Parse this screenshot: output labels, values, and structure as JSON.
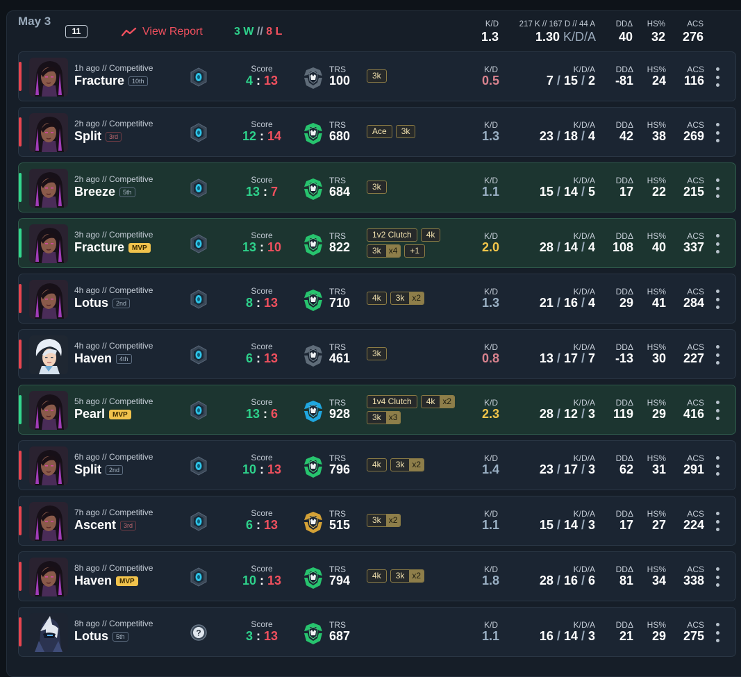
{
  "header": {
    "date": "May 3",
    "match_count": "11",
    "view_report": "View Report",
    "wins": "3 W",
    "sep": " // ",
    "losses": "8 L",
    "kd_label": "K/D",
    "kd_value": "1.3",
    "kda_label": "217 K // 167 D // 44 A",
    "kda_value": "1.30",
    "kda_suffix": " K/D/A",
    "dd_label": "DDΔ",
    "dd_value": "40",
    "hs_label": "HS%",
    "hs_value": "32",
    "acs_label": "ACS",
    "acs_value": "276"
  },
  "labels": {
    "score": "Score",
    "trs": "TRS",
    "kd": "K/D",
    "kda": "K/D/A",
    "dd": "DDΔ",
    "hs": "HS%",
    "acs": "ACS",
    "sep": ":"
  },
  "colors": {
    "win": "#2ed18b",
    "loss": "#f0505e",
    "accent": "#f0505e",
    "mvp": "#f0c24c",
    "kd_high": "#f3c64a"
  },
  "matches": [
    {
      "result": "loss",
      "agent": "reyna",
      "meta": "1h ago // Competitive",
      "map": "Fracture",
      "place": "10th",
      "place_style": "normal",
      "score_us": "4",
      "score_them": "13",
      "rank_icon": "rank-gray-icon",
      "trs": "100",
      "badges": [
        {
          "text": "3k",
          "mult": ""
        }
      ],
      "kd": "0.5",
      "kd_style": "low",
      "k": "7",
      "d": "15",
      "a": "2",
      "dd": "-81",
      "hs": "24",
      "acs": "116"
    },
    {
      "result": "loss",
      "agent": "reyna",
      "meta": "2h ago // Competitive",
      "map": "Split",
      "place": "3rd",
      "place_style": "red",
      "score_us": "12",
      "score_them": "14",
      "rank_icon": "rank-green-icon",
      "trs": "680",
      "badges": [
        {
          "text": "Ace",
          "mult": ""
        },
        {
          "text": "3k",
          "mult": ""
        }
      ],
      "kd": "1.3",
      "kd_style": "mid",
      "k": "23",
      "d": "18",
      "a": "4",
      "dd": "42",
      "hs": "38",
      "acs": "269"
    },
    {
      "result": "win",
      "agent": "reyna",
      "meta": "2h ago // Competitive",
      "map": "Breeze",
      "place": "5th",
      "place_style": "normal",
      "score_us": "13",
      "score_them": "7",
      "rank_icon": "rank-green-icon",
      "trs": "684",
      "badges": [
        {
          "text": "3k",
          "mult": ""
        }
      ],
      "kd": "1.1",
      "kd_style": "mid",
      "k": "15",
      "d": "14",
      "a": "5",
      "dd": "17",
      "hs": "22",
      "acs": "215"
    },
    {
      "result": "win",
      "agent": "reyna",
      "meta": "3h ago // Competitive",
      "map": "Fracture",
      "place": "MVP",
      "place_style": "mvp",
      "score_us": "13",
      "score_them": "10",
      "rank_icon": "rank-green-icon",
      "trs": "822",
      "badges": [
        {
          "text": "1v2 Clutch",
          "mult": ""
        },
        {
          "text": "4k",
          "mult": ""
        },
        {
          "text": "3k",
          "mult": "x4"
        },
        {
          "text": "+1",
          "mult": ""
        }
      ],
      "kd": "2.0",
      "kd_style": "high",
      "k": "28",
      "d": "14",
      "a": "4",
      "dd": "108",
      "hs": "40",
      "acs": "337"
    },
    {
      "result": "loss",
      "agent": "reyna",
      "meta": "4h ago // Competitive",
      "map": "Lotus",
      "place": "2nd",
      "place_style": "normal",
      "score_us": "8",
      "score_them": "13",
      "rank_icon": "rank-green-icon",
      "trs": "710",
      "badges": [
        {
          "text": "4k",
          "mult": ""
        },
        {
          "text": "3k",
          "mult": "x2"
        }
      ],
      "kd": "1.3",
      "kd_style": "mid",
      "k": "21",
      "d": "16",
      "a": "4",
      "dd": "29",
      "hs": "41",
      "acs": "284"
    },
    {
      "result": "loss",
      "agent": "jett",
      "meta": "4h ago // Competitive",
      "map": "Haven",
      "place": "4th",
      "place_style": "normal",
      "score_us": "6",
      "score_them": "13",
      "rank_icon": "rank-gray-icon",
      "trs": "461",
      "badges": [
        {
          "text": "3k",
          "mult": ""
        }
      ],
      "kd": "0.8",
      "kd_style": "low",
      "k": "13",
      "d": "17",
      "a": "7",
      "dd": "-13",
      "hs": "30",
      "acs": "227"
    },
    {
      "result": "win",
      "agent": "reyna",
      "meta": "5h ago // Competitive",
      "map": "Pearl",
      "place": "MVP",
      "place_style": "mvp",
      "score_us": "13",
      "score_them": "6",
      "rank_icon": "rank-blue-icon",
      "trs": "928",
      "badges": [
        {
          "text": "1v4 Clutch",
          "mult": ""
        },
        {
          "text": "4k",
          "mult": "x2"
        },
        {
          "text": "3k",
          "mult": "x3"
        }
      ],
      "kd": "2.3",
      "kd_style": "high",
      "k": "28",
      "d": "12",
      "a": "3",
      "dd": "119",
      "hs": "29",
      "acs": "416"
    },
    {
      "result": "loss",
      "agent": "reyna",
      "meta": "6h ago // Competitive",
      "map": "Split",
      "place": "2nd",
      "place_style": "normal",
      "score_us": "10",
      "score_them": "13",
      "rank_icon": "rank-green-icon",
      "trs": "796",
      "badges": [
        {
          "text": "4k",
          "mult": ""
        },
        {
          "text": "3k",
          "mult": "x2"
        }
      ],
      "kd": "1.4",
      "kd_style": "mid",
      "k": "23",
      "d": "17",
      "a": "3",
      "dd": "62",
      "hs": "31",
      "acs": "291"
    },
    {
      "result": "loss",
      "agent": "reyna",
      "meta": "7h ago // Competitive",
      "map": "Ascent",
      "place": "3rd",
      "place_style": "red",
      "score_us": "6",
      "score_them": "13",
      "rank_icon": "rank-gold-icon",
      "trs": "515",
      "badges": [
        {
          "text": "3k",
          "mult": "x2"
        }
      ],
      "kd": "1.1",
      "kd_style": "mid",
      "k": "15",
      "d": "14",
      "a": "3",
      "dd": "17",
      "hs": "27",
      "acs": "224"
    },
    {
      "result": "loss",
      "agent": "reyna",
      "meta": "8h ago // Competitive",
      "map": "Haven",
      "place": "MVP",
      "place_style": "mvp",
      "score_us": "10",
      "score_them": "13",
      "rank_icon": "rank-green-icon",
      "trs": "794",
      "badges": [
        {
          "text": "4k",
          "mult": ""
        },
        {
          "text": "3k",
          "mult": "x2"
        }
      ],
      "kd": "1.8",
      "kd_style": "mid",
      "k": "28",
      "d": "16",
      "a": "6",
      "dd": "81",
      "hs": "34",
      "acs": "338"
    },
    {
      "result": "loss",
      "agent": "yoru",
      "meta": "8h ago // Competitive",
      "map": "Lotus",
      "place": "5th",
      "place_style": "normal",
      "score_us": "3",
      "score_them": "13",
      "rank_icon": "rank-green-icon",
      "trs": "687",
      "badges": [],
      "kd": "1.1",
      "kd_style": "mid",
      "k": "16",
      "d": "14",
      "a": "3",
      "dd": "21",
      "hs": "29",
      "acs": "275"
    }
  ]
}
